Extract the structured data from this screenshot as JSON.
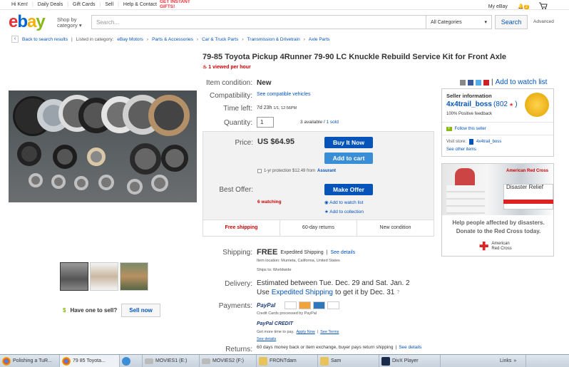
{
  "topnav": {
    "greeting": "Hi Ken!",
    "links": [
      "Daily Deals",
      "Gift Cards",
      "Sell",
      "Help & Contact"
    ],
    "banner_line1": "GET INSTANT",
    "banner_line2": "GIFTS!",
    "my_ebay": "My eBay",
    "notif_count": "2"
  },
  "header": {
    "logo_e": "e",
    "logo_b": "b",
    "logo_a": "a",
    "logo_y": "y",
    "shop_by_1": "Shop by",
    "shop_by_2": "category",
    "search_placeholder": "Search...",
    "category": "All Categories",
    "search_button": "Search",
    "advanced": "Advanced"
  },
  "breadcrumb": {
    "back": "Back to search results",
    "listed": "Listed in category:",
    "items": [
      "eBay Motors",
      "Parts & Accessories",
      "Car & Truck Parts",
      "Transmission & Drivetrain",
      "Axle Parts"
    ]
  },
  "product": {
    "title": "79-85 Toyota Pickup 4Runner 79-90 LC Knuckle Rebuild Service Kit for Front Axle",
    "viewed": "1 viewed per hour",
    "condition_label": "Item condition:",
    "condition": "New",
    "compat_label": "Compatibility:",
    "compat_link": "See compatible vehicles",
    "time_label": "Time left:",
    "time_left": "7d 23h",
    "time_detail": "1/1, 12:56PM",
    "qty_label": "Quantity:",
    "qty": "1",
    "available": "3 available /",
    "sold": "1 sold"
  },
  "pricing": {
    "price_label": "Price:",
    "price": "US $64.95",
    "buy_now": "Buy It Now",
    "add_cart": "Add to cart",
    "protection": "1-yr protection $12.49 from",
    "protection_brand": "Assurant",
    "offer_label": "Best Offer:",
    "make_offer": "Make Offer",
    "watching": "6 watching",
    "add_watch": "Add to watch list",
    "add_collection": "Add to collection",
    "tabs": [
      "Free shipping",
      "60-day returns",
      "New condition"
    ]
  },
  "shipping": {
    "label": "Shipping:",
    "free": "FREE",
    "method": "Expedited Shipping",
    "see_details": "See details",
    "location": "Item location:  Murrieta, California, United States",
    "ships_to": "Ships to:  Worldwide",
    "delivery_label": "Delivery:",
    "delivery_text": "Estimated between Tue. Dec. 29 and Sat. Jan. 2",
    "use_text": "Use",
    "expedited": "Expedited Shipping",
    "by_text": "to get it by Dec. 31",
    "payments_label": "Payments:",
    "paypal": "PayPal",
    "card_note": "Credit Cards processed by PayPal",
    "pp_credit": "PayPal CREDIT",
    "more_time": "Get more time to pay.",
    "apply": "Apply Now",
    "see_terms": "See Terms",
    "see_details2": "See details",
    "returns_label": "Returns:",
    "returns_text": "60 days money back or item exchange, buyer pays return shipping",
    "see_details3": "See details"
  },
  "seller": {
    "watch_link": "Add to watch list",
    "info_title": "Seller information",
    "name": "4x4trail_boss",
    "score": "(802",
    "star": "★",
    "close": ")",
    "positive": "100% Positive feedback",
    "follow": "Follow this seller",
    "visit_store": "Visit store:",
    "store_name": "4x4trail_boss",
    "other_items": "See other items",
    "badge_text": "Top Rated Plus"
  },
  "ad": {
    "brand": "American Red Cross",
    "banner": "Disaster Relief",
    "line1": "Help people affected by disasters.",
    "line2": "Donate to the Red Cross today.",
    "logo_1": "American",
    "logo_2": "Red Cross"
  },
  "sell": {
    "have_one": "Have one to sell?",
    "sell_now": "Sell now"
  },
  "taskbar": {
    "items": [
      "Polishing a TuR...",
      "79 85 Toyota...",
      "",
      "MOVIES1 (E:)",
      "MOVIES2 (F:)",
      "FRONTdam",
      "Sam",
      "DivX Player"
    ],
    "links": "Links"
  },
  "colors": {
    "ebay_red": "#e53238",
    "ebay_blue": "#0064d2",
    "ebay_yellow": "#f5af02",
    "ebay_green": "#86b817",
    "link_blue": "#0654ba"
  }
}
